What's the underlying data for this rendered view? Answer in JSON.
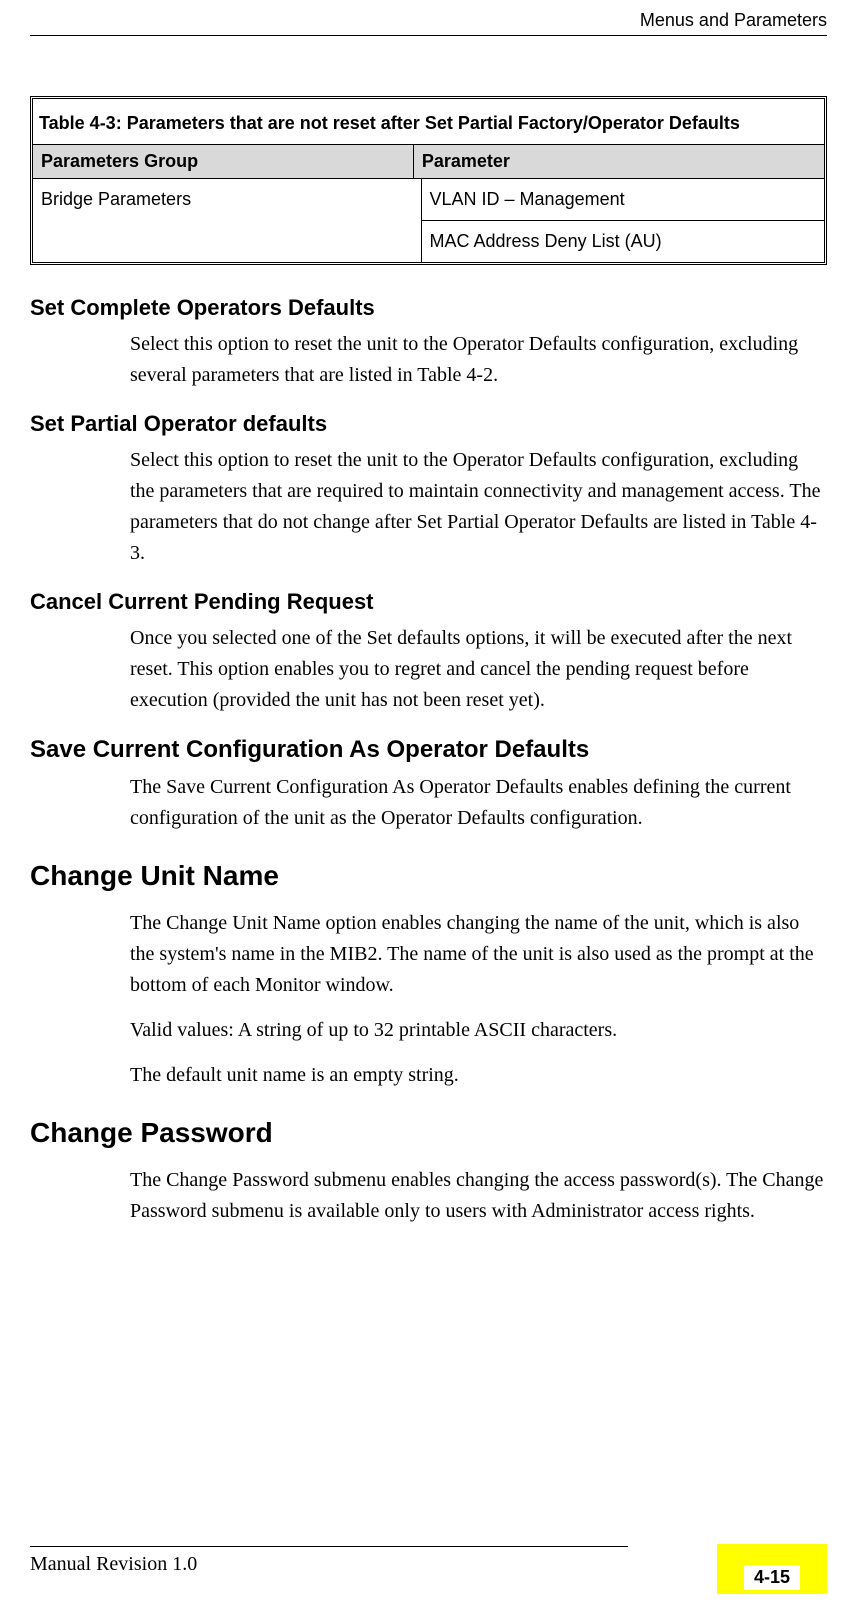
{
  "header": {
    "running_head": "Menus and Parameters"
  },
  "table": {
    "title": "Table 4-3: Parameters that are not reset after Set Partial Factory/Operator Defaults",
    "col1_header": "Parameters Group",
    "col2_header": "Parameter",
    "row_group": "Bridge Parameters",
    "row_params": [
      "VLAN ID – Management",
      "MAC Address Deny List (AU)"
    ]
  },
  "sections": {
    "s1": {
      "heading": "Set Complete Operators Defaults",
      "body": "Select this option to reset the unit to the Operator Defaults configuration, excluding several parameters that are listed in Table 4-2."
    },
    "s2": {
      "heading": "Set Partial Operator defaults",
      "body": "Select this option to reset the unit to the Operator Defaults configuration, excluding the parameters that are required to maintain connectivity and management access. The parameters that do not change after Set Partial Operator Defaults are listed in Table 4-3."
    },
    "s3": {
      "heading": "Cancel Current Pending Request",
      "body": "Once you selected one of the Set defaults options, it will be executed after the next reset. This option enables you to regret and cancel the pending request before execution (provided the unit has not been reset yet)."
    },
    "s4": {
      "heading": "Save Current Configuration As Operator Defaults",
      "body": "The Save Current Configuration As Operator Defaults enables defining the current configuration of the unit as the Operator Defaults configuration."
    },
    "s5": {
      "heading": "Change Unit Name",
      "body1": "The Change Unit Name option enables changing the name of the unit, which is also the system's name in the MIB2. The name of the unit is also used as the prompt at the bottom of each Monitor window.",
      "body2": "Valid values: A string of up to 32 printable ASCII characters.",
      "body3": "The default unit name is an empty string."
    },
    "s6": {
      "heading": "Change Password",
      "body": "The Change Password submenu enables changing the access password(s). The Change Password submenu is available only to users with Administrator access rights."
    }
  },
  "footer": {
    "revision": "Manual Revision 1.0",
    "page_number": "4-15"
  }
}
